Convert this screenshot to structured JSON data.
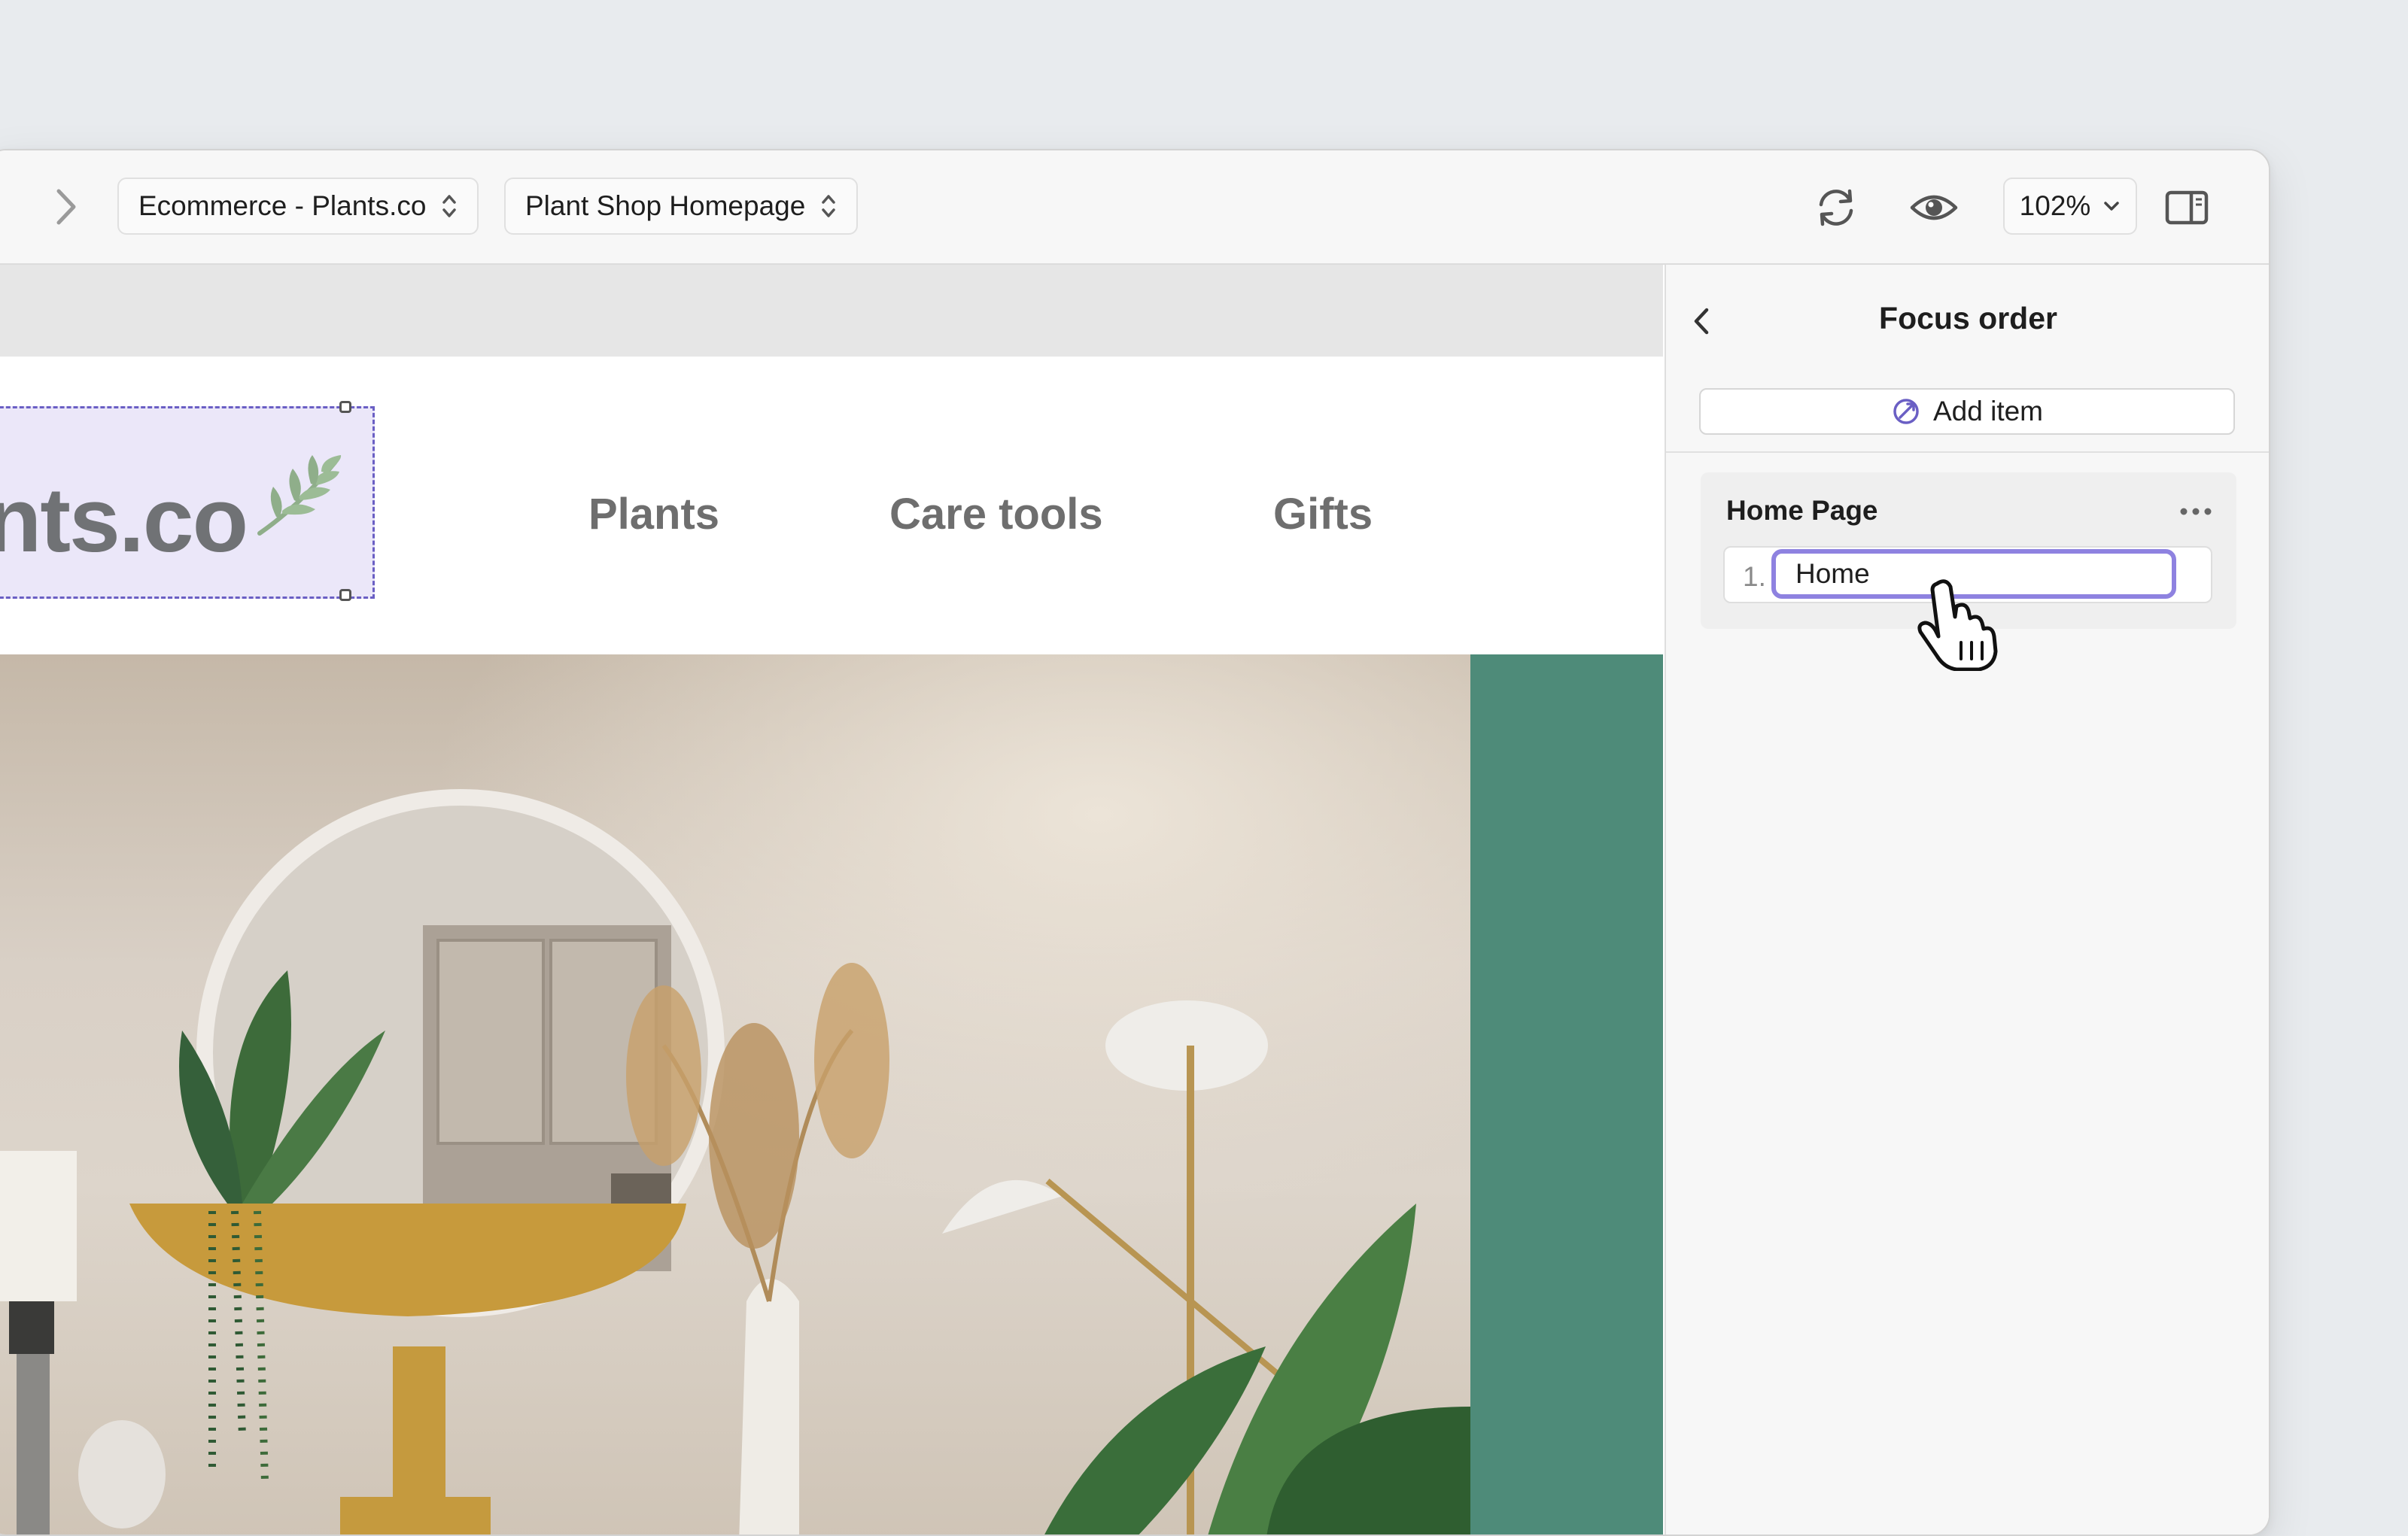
{
  "toolbar": {
    "project_select": "Ecommerce - Plants.co",
    "page_select": "Plant Shop Homepage",
    "zoom_label": "102%",
    "icons": [
      "chevron-right-icon",
      "sync-icon",
      "eye-icon",
      "chevron-down-icon",
      "sidebar-toggle-icon"
    ]
  },
  "canvas": {
    "logo_text": "ants.co",
    "nav": [
      "Plants",
      "Care tools",
      "Gifts"
    ],
    "accent_color": "#4e8b79"
  },
  "panel": {
    "title": "Focus order",
    "add_item_label": "Add item",
    "group": {
      "title": "Home Page",
      "items": [
        {
          "number": "1.",
          "value": "Home"
        }
      ]
    },
    "accent_color": "#8e82e0"
  }
}
